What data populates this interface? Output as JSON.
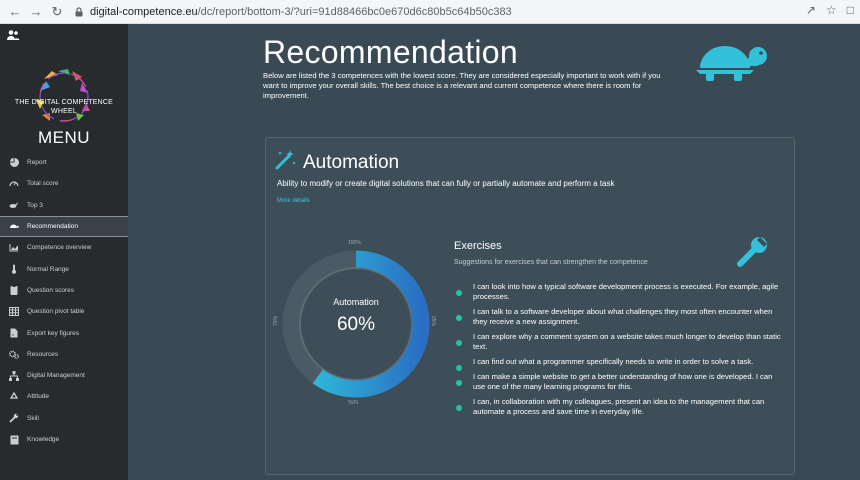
{
  "browser": {
    "back_icon": "arrow-left-icon",
    "forward_icon": "arrow-right-icon",
    "reload_icon": "reload-icon",
    "url_domain": "digital-competence.eu",
    "url_path": "/dc/report/bottom-3/?uri=91d88466bc0e670d6c80b5c64b50c383"
  },
  "sidebar": {
    "logo_text_line1": "THE DIGITAL COMPETENCE",
    "logo_text_line2": "WHEEL",
    "menu_title": "MENU",
    "items": [
      {
        "label": "Report",
        "icon": "pie-chart-icon"
      },
      {
        "label": "Total score",
        "icon": "gauge-icon"
      },
      {
        "label": "Top 3",
        "icon": "hare-icon"
      },
      {
        "label": "Recommendation",
        "icon": "turtle-icon",
        "active": true
      },
      {
        "label": "Competence overview",
        "icon": "area-chart-icon"
      },
      {
        "label": "Normal Range",
        "icon": "thermometer-icon"
      },
      {
        "label": "Question scores",
        "icon": "clipboard-icon"
      },
      {
        "label": "Question pivot table",
        "icon": "table-icon"
      },
      {
        "label": "Export key figures",
        "icon": "export-icon"
      },
      {
        "label": "Resources",
        "icon": "cogs-icon"
      },
      {
        "label": "Digital Management",
        "icon": "sitemap-icon"
      },
      {
        "label": "Attitude",
        "icon": "recycle-icon"
      },
      {
        "label": "Skill",
        "icon": "wrench-icon"
      },
      {
        "label": "Knowledge",
        "icon": "book-icon"
      }
    ]
  },
  "main": {
    "title": "Recommendation",
    "intro": "Below are listed the 3 competences with the lowest score. They are considered especially important to work with if you want to improve your overall skills. The best choice is a relevant and current competence where there is room for improvement.",
    "card": {
      "title": "Automation",
      "description": "Ability to modify or create digital solutions that can fully or partially automate and perform a task",
      "more_details": "More details",
      "gauge": {
        "label": "Automation",
        "value_text": "60%",
        "value": 0.6,
        "tick_top": "100%",
        "tick_left": "75%",
        "tick_right": "25%",
        "tick_bottom": "50%"
      },
      "exercises_title": "Exercises",
      "exercises_subtitle": "Suggestions for exercises that can strengthen the competence",
      "exercises": [
        "I can look into how a typical software development process is executed. For example, agile processes.",
        "I can talk to a software developer about what challenges they most often encounter when they receive a new assignment.",
        "I can explore why a comment system on a website takes much longer to develop than static text.",
        "I can find out what a programmer specifically needs to write in order to solve a task.",
        "I can make a simple website to get a better understanding of how one is developed. I can use one of the many learning programs for this.",
        "I can, in collaboration with my colleagues, present an idea to the management that can automate a process and save time in everyday life."
      ]
    }
  },
  "colors": {
    "accent": "#36c6e6",
    "gauge_start": "#2fc6dc",
    "gauge_end": "#2a6fc4",
    "bullet": "#20c6a8"
  }
}
